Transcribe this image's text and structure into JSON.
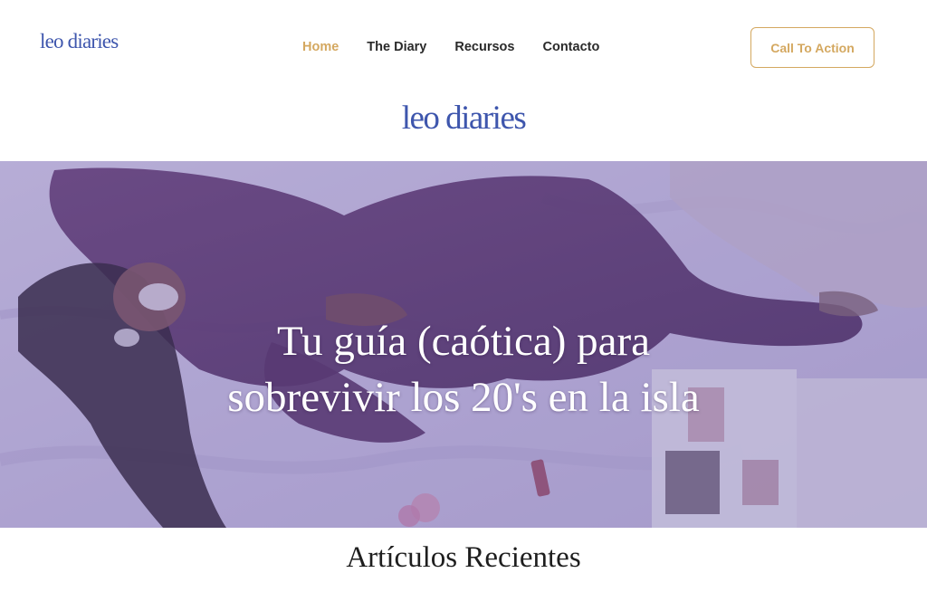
{
  "header": {
    "logo": "leo diaries",
    "nav": [
      {
        "label": "Home",
        "active": true
      },
      {
        "label": "The Diary",
        "active": false
      },
      {
        "label": "Recursos",
        "active": false
      },
      {
        "label": "Contacto",
        "active": false
      }
    ],
    "cta_label": "Call To Action"
  },
  "brand": {
    "logo_large": "leo diaries"
  },
  "hero": {
    "title_line1": "Tu guía (caótica) para",
    "title_line2": "sobrevivir los 20's en la isla"
  },
  "main": {
    "section_title": "Artículos Recientes"
  },
  "colors": {
    "brand_blue": "#3e56ad",
    "accent_gold": "#d4a860",
    "hero_overlay": "#584e9e"
  }
}
